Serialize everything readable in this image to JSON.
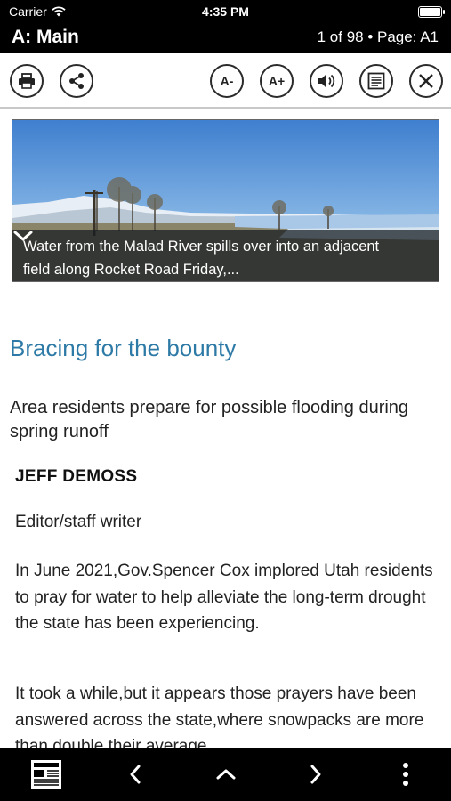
{
  "status_bar": {
    "carrier": "Carrier",
    "time": "4:35 PM"
  },
  "header": {
    "section": "A: Main",
    "page_info": "1 of 98 • Page: A1"
  },
  "toolbar": {
    "print_icon": "printer-icon",
    "share_icon": "share-icon",
    "font_smaller_label": "A-",
    "font_larger_label": "A+",
    "audio_icon": "speaker-icon",
    "text_view_icon": "article-icon",
    "close_icon": "close-icon"
  },
  "hero": {
    "caption": "Water from the Malad River spills over into an adjacent field along Rocket Road Friday,...",
    "expand_icon": "chevron-down-icon"
  },
  "article": {
    "headline": "Bracing for the bounty",
    "subhead": "Area residents prepare for possible flooding during spring runoff",
    "byline": "JEFF DEMOSS",
    "role": "Editor/staff writer",
    "paragraphs": [
      "In June 2021,Gov.Spencer Cox implored Utah residents to pray for water to help alleviate the long-term drought the state has been experiencing.",
      "It took a while,but it appears those prayers have been answered across the state,where snowpacks are more than double their average"
    ]
  },
  "bottom_nav": {
    "pages_icon": "newspaper-pages-icon",
    "prev_icon": "chevron-left-icon",
    "up_icon": "chevron-up-icon",
    "next_icon": "chevron-right-icon",
    "more_icon": "more-vertical-icon"
  },
  "colors": {
    "accent": "#2e7aa6",
    "bar": "#000000"
  }
}
